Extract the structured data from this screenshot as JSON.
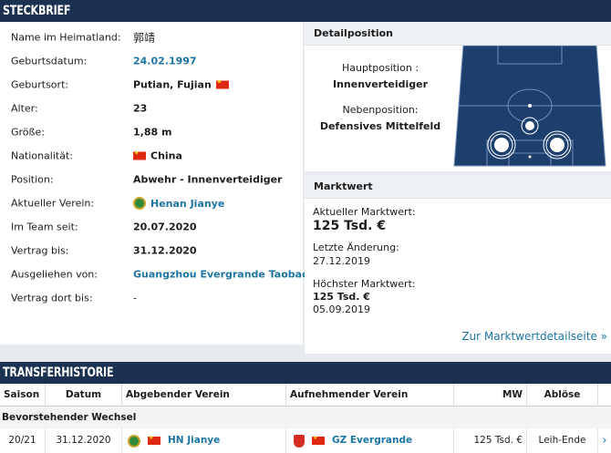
{
  "profile": {
    "title": "STECKBRIEF",
    "rows": [
      {
        "label": "Name im Heimatland:",
        "value": "郭靖"
      },
      {
        "label": "Geburtsdatum:",
        "value": "24.02.1997"
      },
      {
        "label": "Geburtsort:",
        "value": "Putian, Fujian"
      },
      {
        "label": "Alter:",
        "value": "23"
      },
      {
        "label": "Größe:",
        "value": "1,88 m"
      },
      {
        "label": "Nationalität:",
        "value": "China"
      },
      {
        "label": "Position:",
        "value": "Abwehr - Innenverteidiger"
      },
      {
        "label": "Aktueller Verein:",
        "value": "Henan Jianye"
      },
      {
        "label": "Im Team seit:",
        "value": "20.07.2020"
      },
      {
        "label": "Vertrag bis:",
        "value": "31.12.2020"
      },
      {
        "label": "Ausgeliehen von:",
        "value": "Guangzhou Evergrande Taobao"
      },
      {
        "label": "Vertrag dort bis:",
        "value": "-"
      }
    ]
  },
  "detail": {
    "title": "Detailposition",
    "main_label": "Hauptposition :",
    "main_value": "Innenverteidiger",
    "side_label": "Nebenposition:",
    "side_value": "Defensives Mittelfeld"
  },
  "market": {
    "title": "Marktwert",
    "current_label": "Aktueller Marktwert:",
    "current_value": "125 Tsd. €",
    "change_label": "Letzte Änderung:",
    "change_value": "27.12.2019",
    "peak_label": "Höchster Marktwert:",
    "peak_value": "125 Tsd. €",
    "peak_date": "05.09.2019",
    "link": "Zur Marktwertdetailseite »"
  },
  "transfer": {
    "title": "TRANSFERHISTORIE",
    "headers": [
      "Saison",
      "Datum",
      "Abgebender Verein",
      "Aufnehmender Verein",
      "MW",
      "Ablöse"
    ],
    "pending_label": "Bevorstehender Wechsel",
    "row": {
      "season": "20/21",
      "date": "31.12.2020",
      "from": "HN Jianye",
      "to": "GZ Evergrande",
      "mw": "125 Tsd. €",
      "fee": "Leih-Ende"
    }
  },
  "colors": {
    "header_bg": "#1a3151",
    "link": "#1d75a3",
    "pitch": "#1d3f6e"
  }
}
